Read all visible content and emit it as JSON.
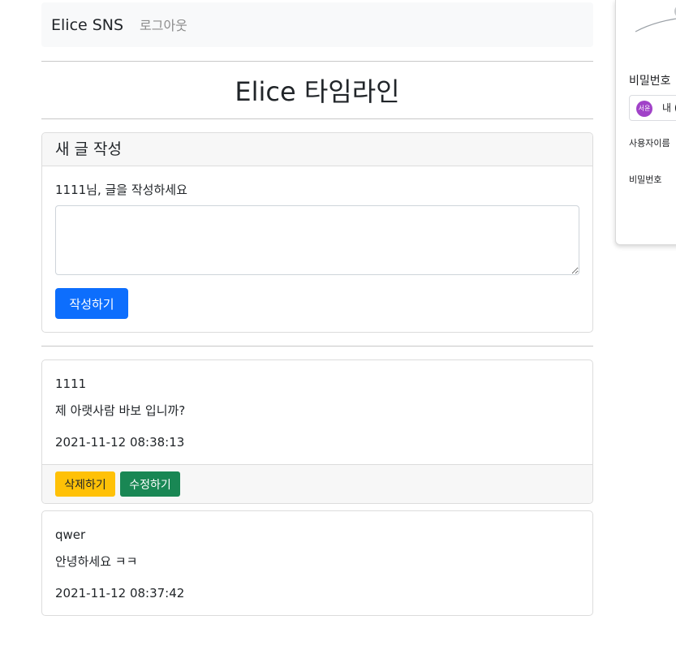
{
  "navbar": {
    "brand": "Elice SNS",
    "logout_label": "로그아웃"
  },
  "page": {
    "title": "Elice 타임라인"
  },
  "compose": {
    "header": "새 글 작성",
    "label": "1111님, 글을 작성하세요",
    "textarea_value": "",
    "submit_label": "작성하기"
  },
  "posts": [
    {
      "author": "1111",
      "content": "제 아랫사람 바보 입니까?",
      "time": "2021-11-12 08:38:13",
      "delete_label": "삭제하기",
      "edit_label": "수정하기"
    },
    {
      "author": "qwer",
      "content": "안녕하세요 ㅋㅋ",
      "time": "2021-11-12 08:37:42"
    }
  ],
  "side_panel": {
    "title": "비밀번호",
    "account_avatar": "서윤",
    "account_text": "내 (",
    "username_label": "사용자이름",
    "password_label": "비밀번호"
  },
  "colors": {
    "primary": "#0d6efd",
    "warning": "#ffc107",
    "success": "#198754",
    "navbar_bg": "#f8f9fa",
    "avatar": "#a142c8"
  }
}
